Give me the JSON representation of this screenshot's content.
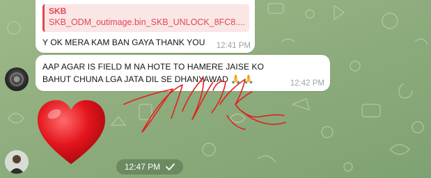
{
  "messages": [
    {
      "reply": {
        "sender": "SKB",
        "file": "SKB_ODM_outimage.bin_SKB_UNLOCK_8FC8...."
      },
      "text": "Y OK MERA KAM BAN GAYA THANK YOU",
      "time": "12:41 PM"
    },
    {
      "text": "AAP AGAR IS FIELD M NA HOTE TO HAMERE JAISE KO BAHUT CHUNA LGA JATA DIL SE DHANYAWAD 🙏 🙏",
      "time": "12:42 PM"
    }
  ],
  "sticker": {
    "icon": "heart-sticker",
    "time": "12:47 PM",
    "status": "sent-check-icon"
  },
  "colors": {
    "accent_red": "#e0484f",
    "bubble": "#ffffff",
    "wallpaper": "#8fad7e"
  }
}
